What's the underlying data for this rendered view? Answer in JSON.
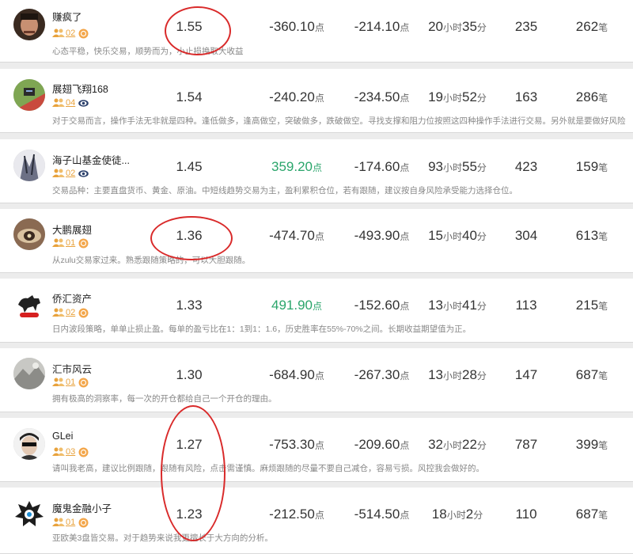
{
  "labels": {
    "point_unit": "点",
    "hour_unit": "小时",
    "minute_unit": "分",
    "trade_unit": "笔"
  },
  "colors": {
    "positive": "#2aa56b",
    "level": "#e8a23c",
    "annotation": "#d92a2a"
  },
  "traders": [
    {
      "name": "赚疯了",
      "level": "02",
      "badge_icon": "orange-coin-icon",
      "desc": "心态平稳，快乐交易，顺势而为，小止损换取大收益",
      "ratio": "1.55",
      "v1": "-360.10",
      "v1_positive": false,
      "v2": "-214.10",
      "hours": "20",
      "minutes": "35",
      "v4": "235",
      "trades": "262"
    },
    {
      "name": "展翅飞翔168",
      "level": "04",
      "badge_icon": "eye-icon",
      "desc": "对于交易而言，操作手法无非就是四种。逢低做多，逢高做空，突破做多，跌破做空。寻找支撑和阻力位按照这四种操作手法进行交易。另外就是要做好风险控制，",
      "ratio": "1.54",
      "v1": "-240.20",
      "v1_positive": false,
      "v2": "-234.50",
      "hours": "19",
      "minutes": "52",
      "v4": "163",
      "trades": "286"
    },
    {
      "name": "海子山基金使徒...",
      "level": "02",
      "badge_icon": "eye-icon",
      "desc": "交易品种：主要直盘货币、黄金、原油。中短线趋势交易为主，盈利累积仓位，若有跟随，建议按自身风险承受能力选择仓位。",
      "ratio": "1.45",
      "v1": "359.20",
      "v1_positive": true,
      "v2": "-174.60",
      "hours": "93",
      "minutes": "55",
      "v4": "423",
      "trades": "159"
    },
    {
      "name": "大鹏展翅",
      "level": "01",
      "badge_icon": "orange-coin-icon",
      "desc": "从zulu交易家过来。熟悉跟随策略的，可以大胆跟随。",
      "ratio": "1.36",
      "v1": "-474.70",
      "v1_positive": false,
      "v2": "-493.90",
      "hours": "15",
      "minutes": "40",
      "v4": "304",
      "trades": "613"
    },
    {
      "name": "侨汇资产",
      "level": "02",
      "badge_icon": "orange-coin-icon",
      "desc": "日内波段策略，单单止损止盈。每单的盈亏比在1：1到1：1.6，历史胜率在55%-70%之间。长期收益期望值为正。",
      "ratio": "1.33",
      "v1": "491.90",
      "v1_positive": true,
      "v2": "-152.60",
      "hours": "13",
      "minutes": "41",
      "v4": "113",
      "trades": "215"
    },
    {
      "name": "汇市风云",
      "level": "01",
      "badge_icon": "orange-coin-icon",
      "desc": "拥有极高的洞察率，每一次的开仓都给自己一个开仓的理由。",
      "ratio": "1.30",
      "v1": "-684.90",
      "v1_positive": false,
      "v2": "-267.30",
      "hours": "13",
      "minutes": "28",
      "v4": "147",
      "trades": "687"
    },
    {
      "name": "GLei",
      "level": "03",
      "badge_icon": "orange-coin-icon",
      "desc": "请叫我老高，建议比例跟随，跟随有风险，点击需谨慎。麻烦跟随的尽量不要自己减仓，容易亏损。风控我会做好的。",
      "ratio": "1.27",
      "v1": "-753.30",
      "v1_positive": false,
      "v2": "-209.60",
      "hours": "32",
      "minutes": "22",
      "v4": "787",
      "trades": "399"
    },
    {
      "name": "魔鬼金融小子",
      "level": "01",
      "badge_icon": "orange-coin-icon",
      "desc": "亚欧美3盘皆交易。对于趋势来说我更擅长于大方向的分析。",
      "ratio": "1.23",
      "v1": "-212.50",
      "v1_positive": false,
      "v2": "-514.50",
      "hours": "18",
      "minutes": "2",
      "v4": "110",
      "trades": "687"
    }
  ]
}
